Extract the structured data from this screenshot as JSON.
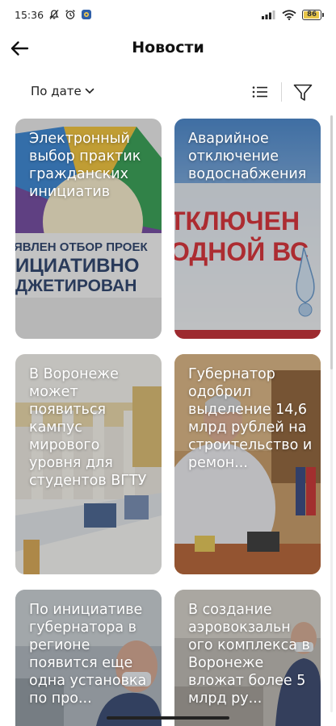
{
  "statusbar": {
    "time": "15:36",
    "battery": "86",
    "battery_fraction": 0.86,
    "icons": [
      "muted-bell-icon",
      "alarm-icon",
      "app-notification-icon",
      "signal-icon",
      "wifi-icon",
      "battery-icon"
    ]
  },
  "appbar": {
    "title": "Новости",
    "back_icon": "arrow-left-icon"
  },
  "filterbar": {
    "sort_label": "По дате",
    "sort_icon": "chevron-down-icon",
    "list_icon": "list-view-icon",
    "filter_icon": "filter-funnel-icon"
  },
  "news": [
    {
      "title": "Электронный выбор практик гражданских инициатив"
    },
    {
      "title": "Аварийное отключение водоснабжения"
    },
    {
      "title": "В Воронеже может появиться кампус мирового уровня для студентов ВГТУ"
    },
    {
      "title": "Губернатор одобрил выделение 14,6 млрд рублей на  строительство и ремон..."
    },
    {
      "title": "По инициативе губернатора в регионе появится еще одна установка по про..."
    },
    {
      "title": "В создание аэровокзальн ого комплекса в Воронеже вложат более 5 млрд ру..."
    }
  ],
  "image_texts": {
    "card1_line1": "ЯВЛЕН ОТБОР ПРОЕК",
    "card1_line2": "ИЦИАТИВНО",
    "card1_line3": "ДЖЕТИРОВАН",
    "card2_line1": "ТКЛЮЧЕН",
    "card2_line2": "ОДНОЙ ВС"
  },
  "colors": {
    "accent_red": "#d4232a",
    "title_text": "#ffffff"
  }
}
